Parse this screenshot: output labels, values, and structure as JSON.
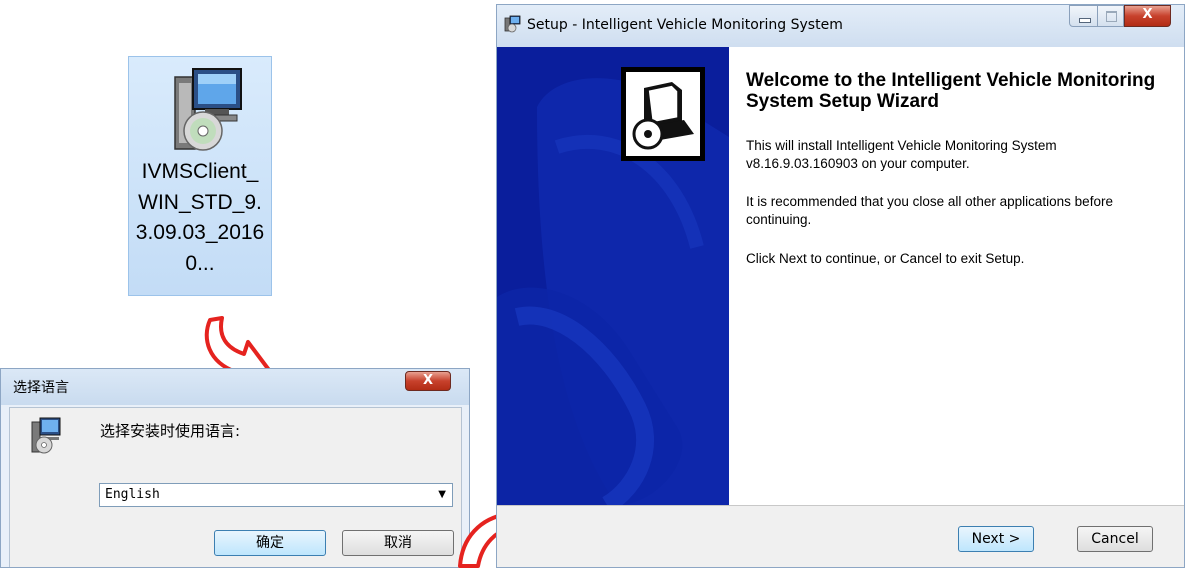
{
  "desktop_icon": {
    "filename": "IVMSClient_WIN_STD_9.3.09.03_20160..."
  },
  "language_dialog": {
    "title": "选择语言",
    "close_label": "X",
    "prompt": "选择安装时使用语言:",
    "selected_language": "English",
    "ok_label": "确定",
    "cancel_label": "取消"
  },
  "setup_wizard": {
    "title": "Setup - Intelligent Vehicle Monitoring System",
    "close_label": "X",
    "heading": "Welcome to the Intelligent Vehicle Monitoring System Setup Wizard",
    "paragraph1": "This will install Intelligent Vehicle Monitoring System v8.16.9.03.160903 on your computer.",
    "paragraph2": "It is recommended that you close all other applications before continuing.",
    "paragraph3": "Click Next to continue, or Cancel to exit Setup.",
    "next_label": "Next >",
    "cancel_label": "Cancel"
  },
  "colors": {
    "arrow_red": "#e5231f",
    "banner_blue": "#0a1e9c",
    "selection_blue": "#cfe3f8"
  }
}
